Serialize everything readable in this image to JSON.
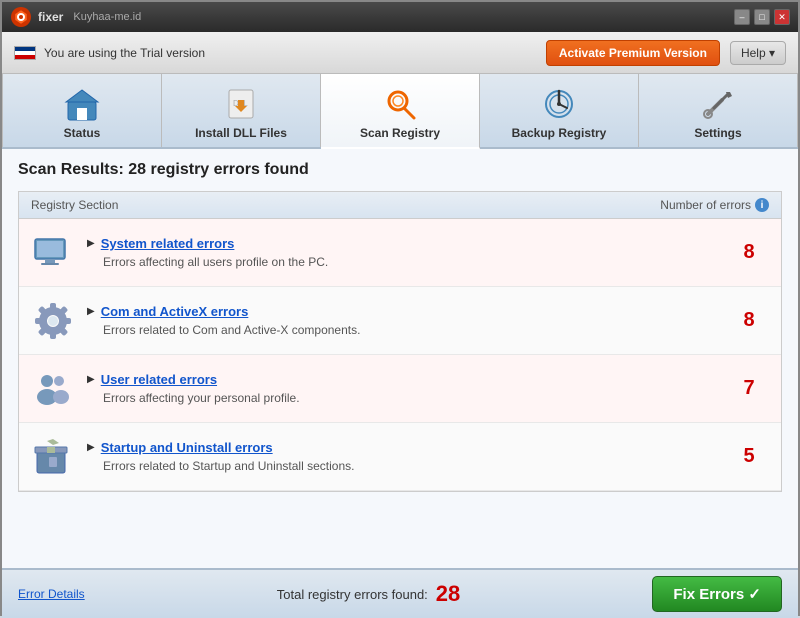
{
  "titlebar": {
    "title": "fixer",
    "watermark": "Kuyhaa-me.id",
    "controls": {
      "minimize": "–",
      "maximize": "□",
      "close": "✕"
    }
  },
  "header": {
    "trial_text": "You are using the Trial version",
    "activate_label": "Activate Premium Version",
    "help_label": "Help ▾"
  },
  "nav": {
    "tabs": [
      {
        "id": "status",
        "label": "Status"
      },
      {
        "id": "install-dll",
        "label": "Install DLL Files"
      },
      {
        "id": "scan-registry",
        "label": "Scan Registry"
      },
      {
        "id": "backup-registry",
        "label": "Backup Registry"
      },
      {
        "id": "settings",
        "label": "Settings"
      }
    ],
    "active": "scan-registry"
  },
  "main": {
    "title_prefix": "Scan Results: ",
    "title_body": "28 registry errors found",
    "table": {
      "col_section": "Registry Section",
      "col_errors": "Number of errors",
      "rows": [
        {
          "icon": "computer",
          "title": "System related errors",
          "desc": "Errors affecting all users profile on the PC.",
          "count": "8"
        },
        {
          "icon": "gear",
          "title": "Com and ActiveX errors",
          "desc": "Errors related to Com and Active-X components.",
          "count": "8"
        },
        {
          "icon": "users",
          "title": "User related errors",
          "desc": "Errors affecting your personal profile.",
          "count": "7"
        },
        {
          "icon": "box",
          "title": "Startup and Uninstall errors",
          "desc": "Errors related to Startup and Uninstall sections.",
          "count": "5"
        }
      ]
    }
  },
  "footer": {
    "link_label": "Error Details",
    "total_label": "Total registry errors found:",
    "total_value": "28",
    "fix_label": "Fix Errors ✓"
  }
}
